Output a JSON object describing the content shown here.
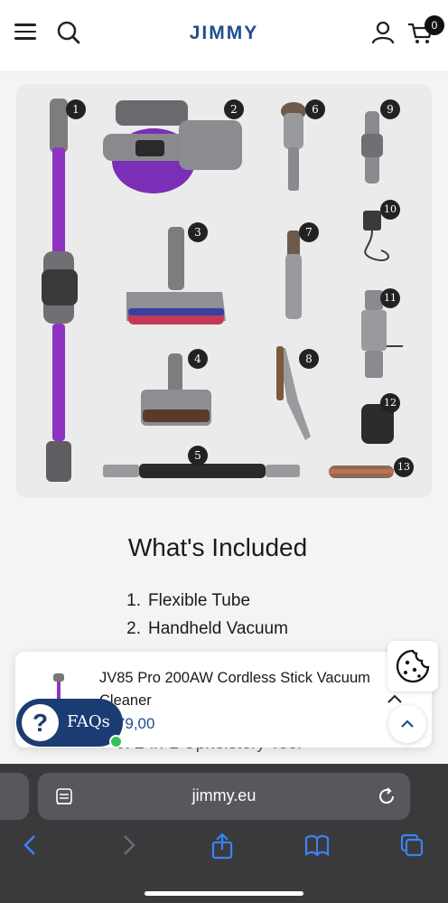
{
  "header": {
    "logo": "JIMMY",
    "cart_count": "0"
  },
  "image_numbers": [
    "1",
    "2",
    "3",
    "4",
    "5",
    "6",
    "7",
    "8",
    "9",
    "10",
    "11",
    "12",
    "13"
  ],
  "section": {
    "title": "What's Included",
    "items": [
      {
        "n": "1.",
        "label": "Flexible Tube"
      },
      {
        "n": "2.",
        "label": "Handheld Vacuum"
      }
    ]
  },
  "sticky": {
    "title": "JV85 Pro 200AW Cordless Stick Vacuum Cleaner",
    "price": "€179,00"
  },
  "faq": {
    "label": "FAQs",
    "q": "?"
  },
  "peek_text": "5. 2-in-1 Upholstery Tool",
  "browser": {
    "url": "jimmy.eu"
  },
  "colors": {
    "brand": "#1f4e8c",
    "faq_bg": "#1b3c73",
    "purple": "#7b2fb0",
    "online": "#35c25a"
  }
}
